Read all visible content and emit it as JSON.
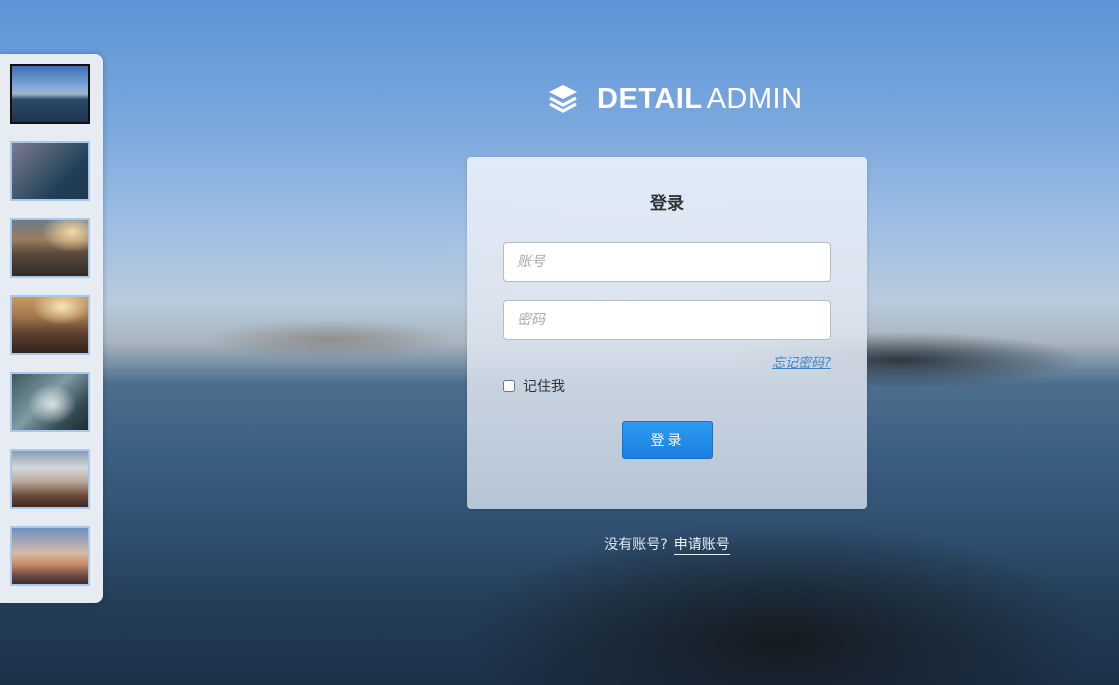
{
  "logo": {
    "icon": "layers-icon",
    "text_strong": "DETAIL",
    "text_light": "ADMIN"
  },
  "login": {
    "title": "登录",
    "account_placeholder": "账号",
    "password_placeholder": "密码",
    "forgot_label": "忘记密码?",
    "remember_label": "记住我",
    "remember_checked": false,
    "submit_label": "登录"
  },
  "signup": {
    "prompt": "没有账号?",
    "link_label": "申请账号"
  },
  "thumbnails": {
    "count": 7,
    "active_index": 0
  },
  "colors": {
    "primary_button": "#1a7fe0",
    "link": "#3a86c8",
    "thumb_border": "#a9c9ec",
    "thumb_active_border": "#111111"
  }
}
